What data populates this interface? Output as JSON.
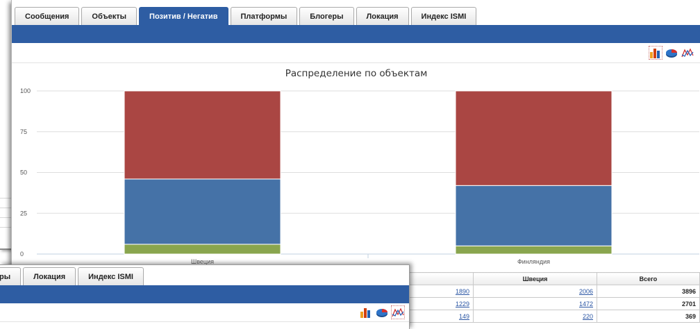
{
  "tabs": [
    "Сообщения",
    "Объекты",
    "Позитив / Негатив",
    "Платформы",
    "Блогеры",
    "Локация",
    "Индекс ISMI"
  ],
  "active_tab": "Позитив / Негатив",
  "front_tabs": [
    "ры",
    "Локация",
    "Индекс ISMI"
  ],
  "toolbar_icons": [
    "bar-chart-icon",
    "pie-chart-icon",
    "line-chart-icon"
  ],
  "chart_data": {
    "type": "bar",
    "stacked": true,
    "title": "Распределение по объектам",
    "categories": [
      "Швеция",
      "Финляндия"
    ],
    "series": [
      {
        "values": [
          6,
          5
        ],
        "color": "#89a54e"
      },
      {
        "values": [
          40,
          37
        ],
        "color": "#4572a7"
      },
      {
        "values": [
          54,
          58
        ],
        "color": "#aa4643"
      }
    ],
    "yticks": [
      "0",
      "25",
      "50",
      "75",
      "100"
    ],
    "ylim": [
      0,
      100
    ],
    "grid": true
  },
  "table": {
    "headers": [
      "",
      "Швеция",
      "Всего"
    ],
    "rows": [
      [
        "1890",
        "2006",
        "3896"
      ],
      [
        "1229",
        "1472",
        "2701"
      ],
      [
        "149",
        "220",
        "369"
      ]
    ]
  },
  "colors": {
    "accent": "#2e5da3"
  }
}
